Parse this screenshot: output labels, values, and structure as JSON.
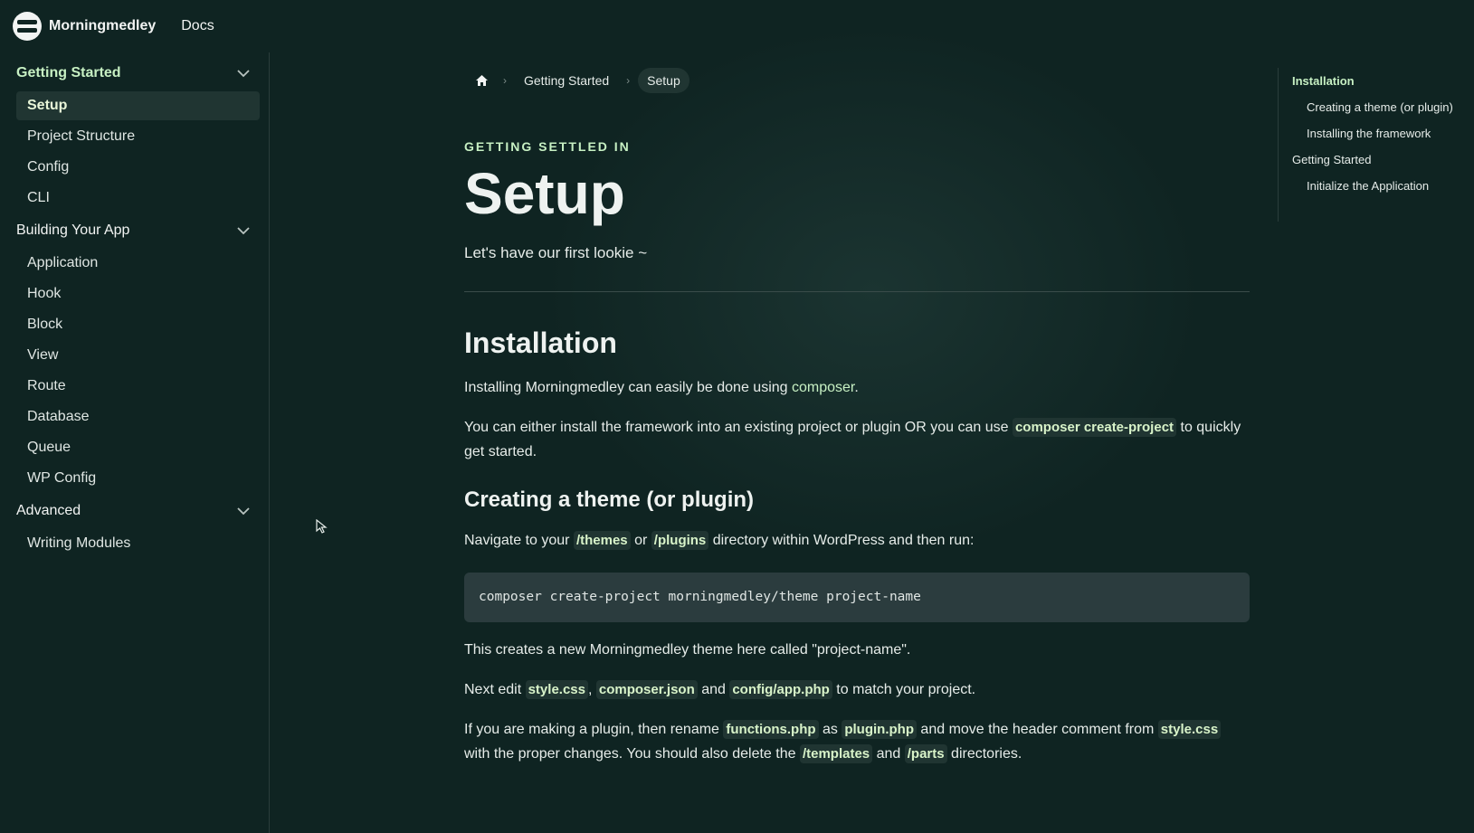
{
  "header": {
    "brand": "Morningmedley",
    "docs_link": "Docs"
  },
  "sidebar": {
    "groups": [
      {
        "title": "Getting Started",
        "items": [
          "Setup",
          "Project Structure",
          "Config",
          "CLI"
        ]
      },
      {
        "title": "Building Your App",
        "items": [
          "Application",
          "Hook",
          "Block",
          "View",
          "Route",
          "Database",
          "Queue",
          "WP Config"
        ]
      },
      {
        "title": "Advanced",
        "items": [
          "Writing Modules"
        ]
      }
    ]
  },
  "breadcrumb": {
    "items": [
      "Getting Started",
      "Setup"
    ]
  },
  "main": {
    "eyebrow": "GETTING SETTLED IN",
    "title": "Setup",
    "lede": "Let's have our first lookie ~",
    "installation": {
      "heading": "Installation",
      "p1_text": "Installing Morningmedley can easily be done using ",
      "p1_link": "composer",
      "p1_end": ".",
      "p2_a": "You can either install the framework into an existing project or plugin OR you can use ",
      "p2_code": "composer create-project",
      "p2_b": " to quickly get started."
    },
    "creating": {
      "heading": "Creating a theme (or plugin)",
      "p1_a": "Navigate to your ",
      "p1_code1": "/themes",
      "p1_b": " or ",
      "p1_code2": "/plugins",
      "p1_c": " directory within WordPress and then run:",
      "command": "composer create-project morningmedley/theme project-name",
      "p2": "This creates a new Morningmedley theme here called \"project-name\".",
      "p3_a": "Next edit ",
      "p3_code1": "style.css",
      "p3_b": ", ",
      "p3_code2": "composer.json",
      "p3_c": " and ",
      "p3_code3": "config/app.php",
      "p3_d": " to match your project.",
      "p4_a": "If you are making a plugin, then rename ",
      "p4_code1": "functions.php",
      "p4_b": " as ",
      "p4_code2": "plugin.php",
      "p4_c": " and move the header comment from ",
      "p4_code3": "style.css",
      "p4_d": " with the proper changes. You should also delete the ",
      "p4_code4": "/templates",
      "p4_e": " and ",
      "p4_code5": "/parts",
      "p4_f": " directories."
    }
  },
  "toc": {
    "items": [
      {
        "label": "Installation",
        "level": 1
      },
      {
        "label": "Creating a theme (or plugin)",
        "level": 2
      },
      {
        "label": "Installing the framework",
        "level": 2
      },
      {
        "label": "Getting Started",
        "level": 1
      },
      {
        "label": "Initialize the Application",
        "level": 2
      }
    ]
  },
  "colors": {
    "background": "#0f2422",
    "accent": "#c7f0c3",
    "code_bg": "#2b3c3e"
  },
  "icons": [
    "home-icon",
    "chevron-right-icon",
    "chevron-down-icon",
    "cursor-icon"
  ]
}
